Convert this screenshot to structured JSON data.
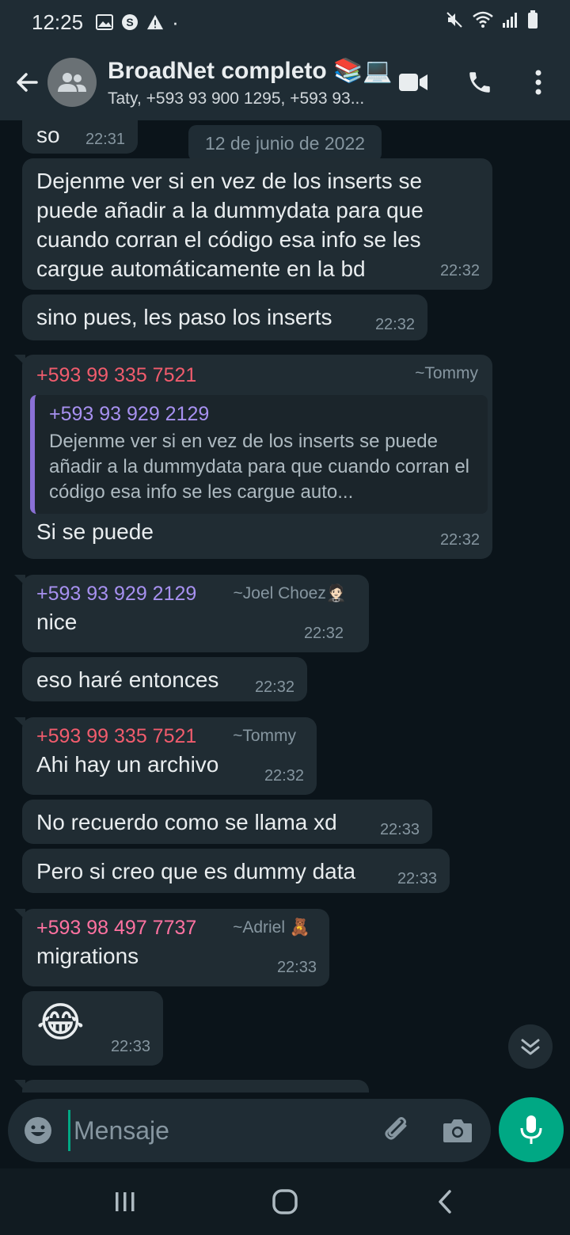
{
  "status_bar": {
    "time": "12:25",
    "dot": "·"
  },
  "header": {
    "title": "BroadNet completo 📚💻",
    "subtitle": "Taty, +593 93 900 1295, +593 93..."
  },
  "date_chip": "12 de junio de 2022",
  "messages": {
    "m0": {
      "text": "so",
      "time": "22:31"
    },
    "m1": {
      "text": "Dejenme ver si en vez de los inserts se puede añadir a la dummydata para que cuando corran el código esa info se les cargue automáticamente en la bd",
      "time": "22:32"
    },
    "m2": {
      "text": "sino pues, les paso los inserts",
      "time": "22:32"
    },
    "m3": {
      "sender": "+593 99 335 7521",
      "alias": "~Tommy",
      "quote_sender": "+593 93 929 2129",
      "quote_text": "Dejenme ver si en vez de los inserts se puede añadir a la dummydata para que cuando corran el código esa info se les cargue auto...",
      "text": "Si se puede",
      "time": "22:32"
    },
    "m4": {
      "sender": "+593 93 929 2129",
      "alias": "~Joel Choez🤵🏻",
      "text": "nice",
      "time": "22:32"
    },
    "m5": {
      "text": "eso haré entonces",
      "time": "22:32"
    },
    "m6": {
      "sender": "+593 99 335 7521",
      "alias": "~Tommy",
      "text": "Ahi hay un archivo",
      "time": "22:32"
    },
    "m7": {
      "text": "No recuerdo como se llama xd",
      "time": "22:33"
    },
    "m8": {
      "text": "Pero si creo que es dummy data",
      "time": "22:33"
    },
    "m9": {
      "sender": "+593 98 497 7737",
      "alias": "~Adriel 🧸",
      "text": "migrations",
      "time": "22:33"
    },
    "m10": {
      "text": "😂",
      "time": "22:33"
    }
  },
  "composer": {
    "placeholder": "Mensaje"
  },
  "colors": {
    "sender_red": "#f15c6d",
    "sender_purple": "#a791f0",
    "sender_pink": "#ff72a1",
    "accent": "#00a884"
  },
  "icons": [
    "back-arrow-icon",
    "group-avatar-icon",
    "video-call-icon",
    "phone-icon",
    "more-vert-icon",
    "scroll-down-icon",
    "emoji-icon",
    "attach-icon",
    "camera-icon",
    "mic-icon"
  ]
}
